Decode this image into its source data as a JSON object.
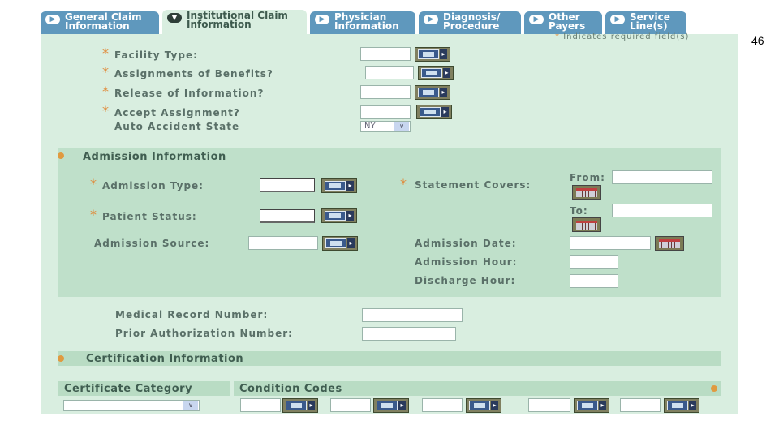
{
  "slide_number": "46",
  "tabs": [
    {
      "label_line1": "General Claim",
      "label_line2": "Information",
      "icon": "arrow-right-icon",
      "active": false
    },
    {
      "label_line1": "Institutional Claim",
      "label_line2": "Information",
      "icon": "arrow-down-icon",
      "active": true
    },
    {
      "label_line1": "Physician",
      "label_line2": "Information",
      "icon": "arrow-right-icon",
      "active": false
    },
    {
      "label_line1": "Diagnosis/",
      "label_line2": "Procedure",
      "icon": "arrow-right-icon",
      "active": false
    },
    {
      "label_line1": "Other",
      "label_line2": "Payers",
      "icon": "arrow-right-icon",
      "active": false
    },
    {
      "label_line1": "Service",
      "label_line2": "Line(s)",
      "icon": "arrow-right-icon",
      "active": false
    }
  ],
  "required_note": "Indicates required field(s)",
  "required_marker": "*",
  "claim_fields": {
    "facility_type": "Facility Type:",
    "assignments_of_benefits": "Assignments of Benefits?",
    "release_of_information": "Release of Information?",
    "accept_assignment": "Accept Assignment?",
    "auto_accident_state": "Auto Accident State",
    "auto_accident_state_value": "NY"
  },
  "admission": {
    "title": "Admission Information",
    "admission_type": "Admission Type:",
    "patient_status": "Patient Status:",
    "admission_source": "Admission Source:",
    "statement_covers": "Statement Covers:",
    "from": "From:",
    "to": "To:",
    "admission_date": "Admission Date:",
    "admission_hour": "Admission Hour:",
    "discharge_hour": "Discharge Hour:"
  },
  "record": {
    "medical_record_number": "Medical Record Number:",
    "prior_authorization_number": "Prior Authorization Number:"
  },
  "certification": {
    "title": "Certification Information",
    "certificate_category": "Certificate Category",
    "condition_codes": "Condition Codes"
  },
  "colors": {
    "panel_bg": "#d9eee0",
    "tab_bg": "#5f98bd",
    "required_star": "#e08a3a"
  }
}
